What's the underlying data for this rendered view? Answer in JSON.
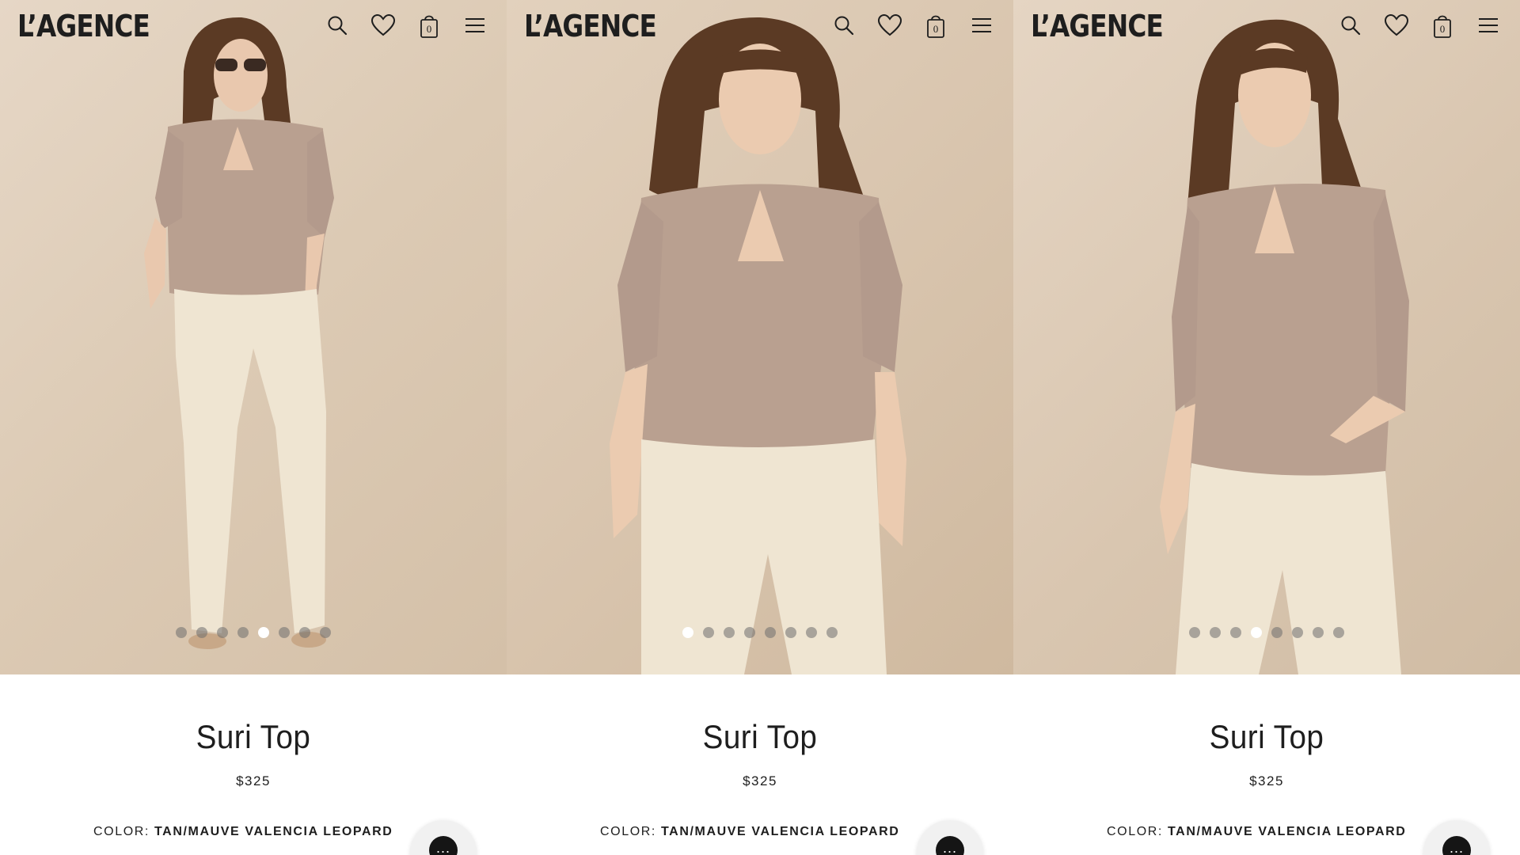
{
  "brand": {
    "logo_text": "L’AGENCE"
  },
  "header": {
    "icons": [
      "search-icon",
      "heart-icon",
      "bag-icon",
      "menu-icon"
    ],
    "bag_count": "0"
  },
  "panels": [
    {
      "active_slide": 5,
      "slide_count": 8
    },
    {
      "active_slide": 1,
      "slide_count": 8
    },
    {
      "active_slide": 4,
      "slide_count": 8
    }
  ],
  "product": {
    "name": "Suri Top",
    "price": "$325",
    "color_label": "COLOR:",
    "color_value": "TAN/MAUVE VALENCIA LEOPARD"
  },
  "chat": {
    "icon": "chat-dots-icon",
    "glyph": "..."
  },
  "colors": {
    "background_beige": "#dccab4",
    "text_dark": "#1e1e1e",
    "jeans_cream": "#efe5d2",
    "blouse_print": "#b9a090",
    "hair_brown": "#5b3a24"
  }
}
